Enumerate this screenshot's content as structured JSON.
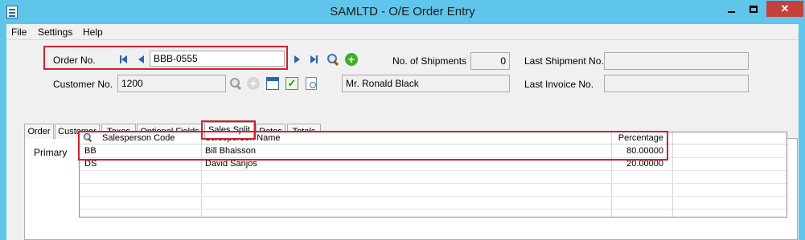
{
  "window": {
    "title": "SAMLTD - O/E Order Entry"
  },
  "menu": {
    "items": [
      "File",
      "Settings",
      "Help"
    ]
  },
  "header": {
    "order_no_label": "Order No.",
    "order_no_value": "BBB-0555",
    "customer_no_label": "Customer No.",
    "customer_no_value": "1200",
    "customer_name": "Mr. Ronald Black",
    "shipments_label": "No. of Shipments",
    "shipments_value": "0",
    "last_shipment_label": "Last Shipment No.",
    "last_shipment_value": "",
    "last_invoice_label": "Last Invoice No.",
    "last_invoice_value": ""
  },
  "tabs": [
    {
      "label": "Order",
      "active": false
    },
    {
      "label": "Customer",
      "active": false
    },
    {
      "label": "Taxes",
      "active": false
    },
    {
      "label": "Optional Fields",
      "active": false
    },
    {
      "label": "Sales Split",
      "active": true
    },
    {
      "label": "Rates",
      "active": false
    },
    {
      "label": "Totals",
      "active": false
    }
  ],
  "sales_split": {
    "primary_label": "Primary",
    "columns": [
      "Salesperson Code",
      "Salesperson Name",
      "Percentage"
    ],
    "rows": [
      {
        "code": "BB",
        "name": "Bill Bhaisson",
        "percentage": "80.00000"
      },
      {
        "code": "DS",
        "name": "David Sanjos",
        "percentage": "20.00000"
      }
    ]
  },
  "colors": {
    "titlebar": "#5fc5ea",
    "highlight_frame": "#d0212b",
    "close_button": "#c7403a"
  }
}
